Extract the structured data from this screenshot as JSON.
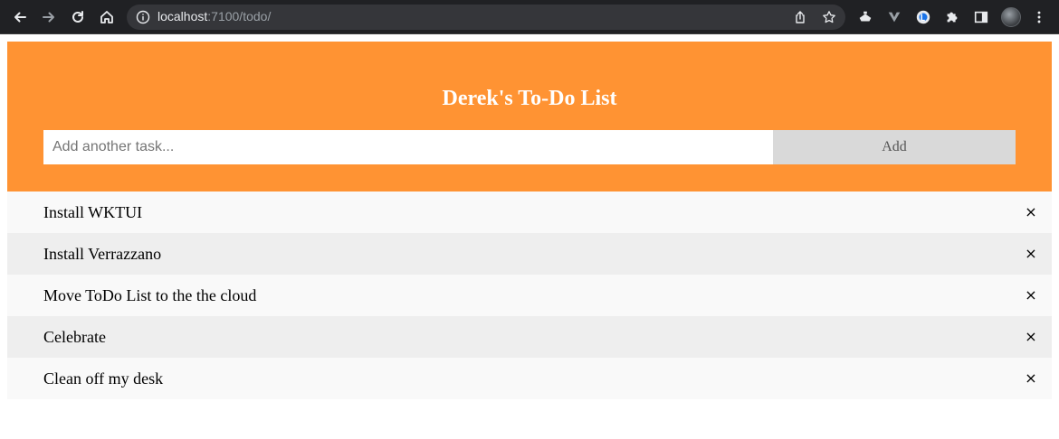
{
  "browser": {
    "url_host": "localhost",
    "url_rest": ":7100/todo/",
    "icons": [
      "back-icon",
      "forward-icon",
      "reload-icon",
      "home-icon",
      "info-icon",
      "share-icon",
      "bookmark-star-icon",
      "extension-icon",
      "puzzle-icon",
      "sidebar-icon",
      "avatar",
      "menu-icon"
    ]
  },
  "app": {
    "title": "Derek's To-Do List",
    "input_placeholder": "Add another task...",
    "add_label": "Add",
    "accent_color": "#ff9333"
  },
  "tasks": [
    {
      "label": "Install WKTUI",
      "close": "×"
    },
    {
      "label": "Install Verrazzano",
      "close": "×"
    },
    {
      "label": "Move ToDo List to the the cloud",
      "close": "×"
    },
    {
      "label": "Celebrate",
      "close": "×"
    },
    {
      "label": "Clean off my desk",
      "close": "×"
    }
  ]
}
